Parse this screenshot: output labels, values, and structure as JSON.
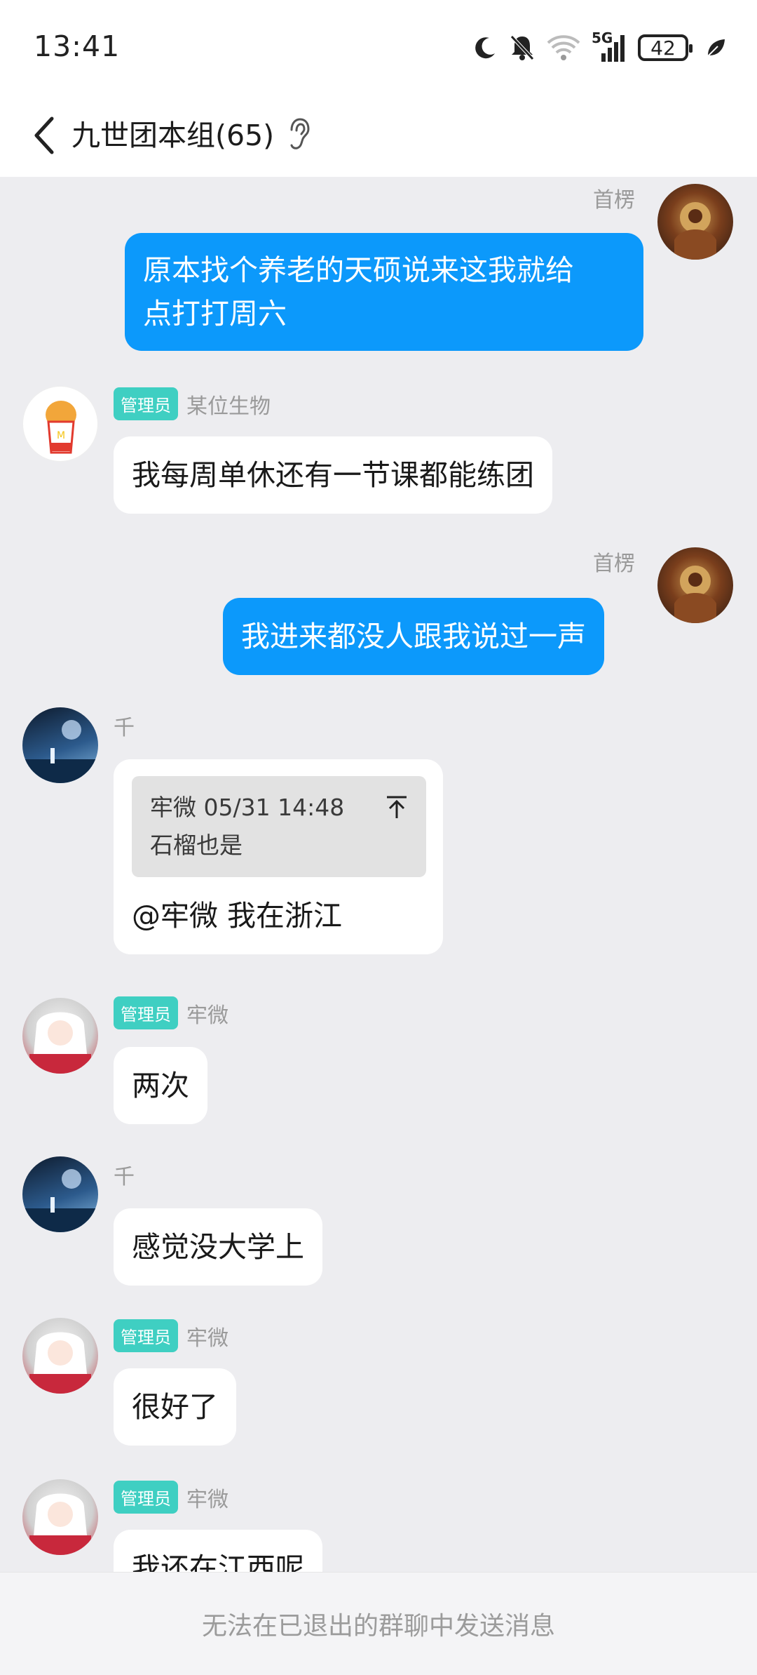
{
  "status_bar": {
    "time": "13:41",
    "network_label": "5G",
    "battery_level": "42",
    "icons": [
      "moon-icon",
      "bell-muted-icon",
      "wifi-icon",
      "signal-icon",
      "battery-icon",
      "leaf-icon"
    ]
  },
  "header": {
    "title": "九世团本组(65)"
  },
  "messages": [
    {
      "sender": "首楞",
      "outgoing": true,
      "text_lines": [
        "原本找个养老的天硕说来这我就给",
        "点打打周六"
      ]
    },
    {
      "sender": "某位生物",
      "badge": "管理员",
      "outgoing": false,
      "text": "我每周单休还有一节课都能练团"
    },
    {
      "sender": "首楞",
      "outgoing": true,
      "text": "我进来都没人跟我说过一声"
    },
    {
      "sender": "千",
      "outgoing": false,
      "quote": {
        "author": "牢微",
        "time": "05/31 14:48",
        "text": "石榴也是"
      },
      "text": "@牢微 我在浙江"
    },
    {
      "sender": "牢微",
      "badge": "管理员",
      "outgoing": false,
      "text": "两次"
    },
    {
      "sender": "千",
      "outgoing": false,
      "text": "感觉没大学上"
    },
    {
      "sender": "牢微",
      "badge": "管理员",
      "outgoing": false,
      "text": "很好了"
    },
    {
      "sender": "牢微",
      "badge": "管理员",
      "outgoing": false,
      "text": "我还在江西呢"
    }
  ],
  "footer": {
    "notice": "无法在已退出的群聊中发送消息"
  },
  "colors": {
    "outgoing_bubble": "#0c99fb",
    "incoming_bubble": "#ffffff",
    "admin_badge": "#3fcfc2",
    "chat_background": "#ededf0"
  }
}
